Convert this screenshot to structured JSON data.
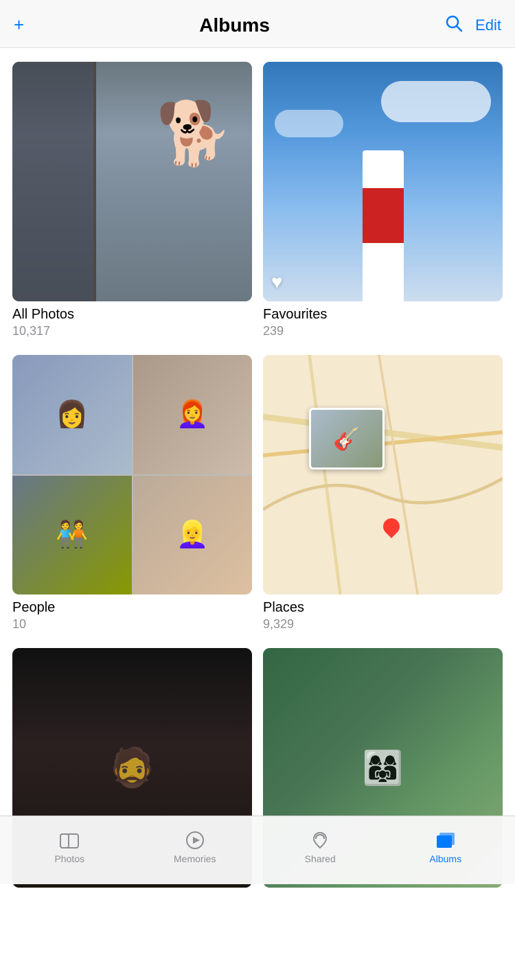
{
  "header": {
    "title": "Albums",
    "add_label": "+",
    "edit_label": "Edit"
  },
  "albums": [
    {
      "id": "all-photos",
      "name": "All Photos",
      "count": "10,317",
      "type": "allphotos"
    },
    {
      "id": "favourites",
      "name": "Favourites",
      "count": "239",
      "type": "favourites"
    },
    {
      "id": "people",
      "name": "People",
      "count": "10",
      "type": "people"
    },
    {
      "id": "places",
      "name": "Places",
      "count": "9,329",
      "type": "places"
    },
    {
      "id": "album5",
      "name": "",
      "count": "",
      "type": "dark"
    },
    {
      "id": "album6",
      "name": "",
      "count": "",
      "type": "group"
    }
  ],
  "bottom_nav": {
    "items": [
      {
        "id": "photos",
        "label": "Photos",
        "active": false
      },
      {
        "id": "memories",
        "label": "Memories",
        "active": false
      },
      {
        "id": "shared",
        "label": "Shared",
        "active": false
      },
      {
        "id": "albums",
        "label": "Albums",
        "active": true
      }
    ]
  },
  "colors": {
    "accent": "#007aff"
  }
}
